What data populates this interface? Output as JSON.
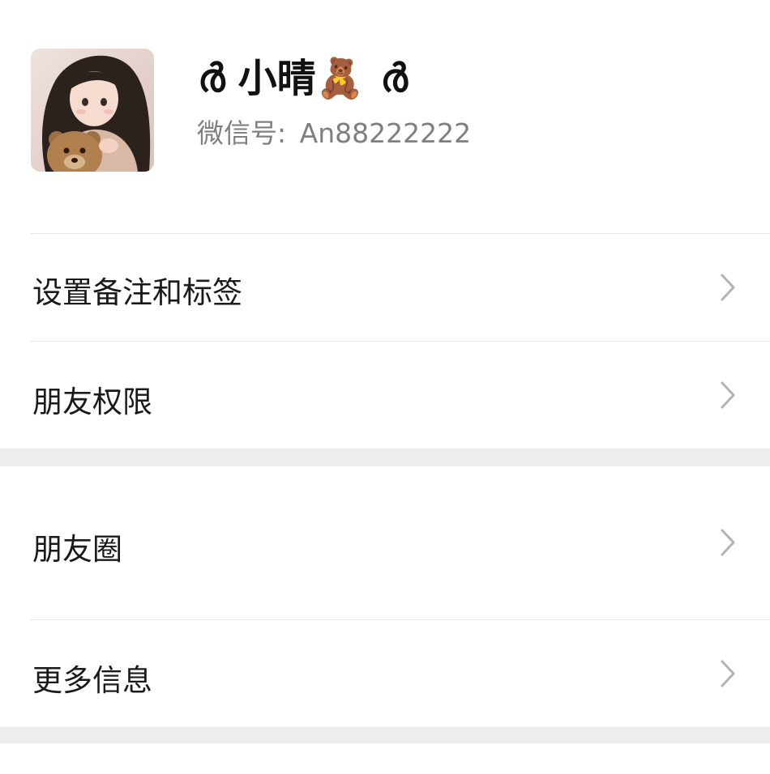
{
  "profile": {
    "name_prefix": "ർ",
    "name_main": "小晴",
    "name_emoji": "🧸",
    "name_suffix": "ർ",
    "wechat_id_label": "微信号:",
    "wechat_id_value": "An88222222"
  },
  "menu": {
    "remark_tags": "设置备注和标签",
    "friend_permissions": "朋友权限",
    "moments": "朋友圈",
    "more_info": "更多信息"
  },
  "icons": {
    "row_arrow": "chevron-right-icon",
    "avatar": "avatar-image"
  },
  "colors": {
    "background": "#ffffff",
    "section_gap": "#ededed",
    "divider": "#e5e5e5",
    "secondary_text": "#7f7f7f",
    "chevron": "#b3b3b3"
  }
}
